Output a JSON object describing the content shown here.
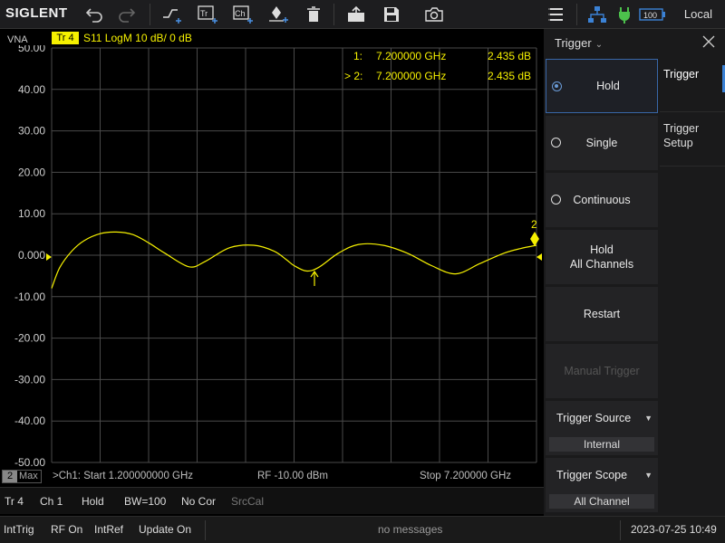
{
  "brand": "SIGLENT",
  "toolbar": {
    "icons": [
      "undo-icon",
      "redo-icon",
      "measure-icon",
      "trace-add-icon",
      "channel-add-icon",
      "marker-add-icon",
      "delete-icon",
      "open-icon",
      "save-icon",
      "camera-icon",
      "menu-icon",
      "network-icon",
      "power-icon",
      "battery-icon"
    ],
    "battery": "100",
    "status": "Local"
  },
  "plot": {
    "vna_label": "VNA",
    "trace_tag": "Tr 4",
    "trace_info": "S11  LogM  10 dB/  0 dB",
    "y_labels": [
      "50.00",
      "40.00",
      "30.00",
      "20.00",
      "10.00",
      "0.000",
      "-10.00",
      "-20.00",
      "-30.00",
      "-40.00",
      "-50.00"
    ],
    "markers": [
      {
        "label": "1:",
        "freq": "7.200000 GHz",
        "value": "2.435 dB"
      },
      {
        "label": "> 2:",
        "freq": "7.200000 GHz",
        "value": "2.435 dB"
      }
    ],
    "marker_2_num": "2",
    "footer": {
      "trace_num": "2",
      "trace_mode": "Max",
      "start": ">Ch1: Start 1.200000000 GHz",
      "power": "RF -10.00 dBm",
      "stop": "Stop 7.200000 GHz"
    }
  },
  "chart_data": {
    "type": "line",
    "title": "",
    "xlabel": "",
    "ylabel": "",
    "xlim": [
      1.2,
      7.2
    ],
    "ylim": [
      -50,
      50
    ],
    "x": [
      1.2,
      1.3,
      1.45,
      1.6,
      1.8,
      2.0,
      2.2,
      2.4,
      2.6,
      2.9,
      3.1,
      3.4,
      3.7,
      3.95,
      4.1,
      4.2,
      4.35,
      4.5,
      4.75,
      5.0,
      5.3,
      5.6,
      5.9,
      6.2,
      6.5,
      6.8,
      7.0,
      7.2
    ],
    "series": [
      {
        "values": [
          -8.0,
          -3.0,
          1.0,
          3.5,
          5.2,
          5.6,
          5.0,
          3.0,
          0.5,
          -2.8,
          -1.5,
          1.8,
          2.4,
          1.0,
          -1.0,
          -2.5,
          -3.8,
          -3.0,
          0.5,
          2.6,
          2.4,
          0.5,
          -2.5,
          -4.5,
          -2.0,
          0.5,
          1.6,
          2.4
        ]
      }
    ],
    "grid": true
  },
  "status_line": {
    "trace": "Tr 4",
    "channel": "Ch 1",
    "hold": "Hold",
    "bw": "BW=100",
    "cor": "No Cor",
    "srccal": "SrcCal"
  },
  "bottom_bar": {
    "inttrig": "IntTrig",
    "rf": "RF On",
    "intref": "IntRef",
    "update": "Update On",
    "message": "no messages",
    "datetime": "2023-07-25 10:49"
  },
  "panel": {
    "title": "Trigger",
    "buttons": {
      "hold": "Hold",
      "single": "Single",
      "continuous": "Continuous",
      "hold_all_1": "Hold",
      "hold_all_2": "All Channels",
      "restart": "Restart",
      "manual": "Manual Trigger"
    },
    "source": {
      "label": "Trigger Source",
      "value": "Internal"
    },
    "scope": {
      "label": "Trigger Scope",
      "value": "All Channel"
    },
    "tabs": [
      {
        "line1": "Trigger",
        "line2": ""
      },
      {
        "line1": "Trigger",
        "line2": "Setup"
      }
    ]
  },
  "colors": {
    "trace": "#f5f000",
    "accent": "#3b82d6",
    "grid": "#4a4a4a"
  }
}
